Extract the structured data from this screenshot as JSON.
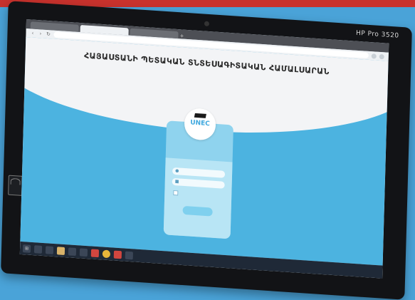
{
  "monitor": {
    "brand": "HP Pro 3520"
  },
  "browser": {
    "tabs": [
      {
        "label": ""
      },
      {
        "label": ""
      },
      {
        "label": ""
      }
    ],
    "url": "",
    "new_tab": "+"
  },
  "page": {
    "title": "ՀԱՅԱՍՏԱՆԻ ՊԵՏԱԿԱՆ ՏՆՏԵՍԱԳԻՏԱԿԱՆ ՀԱՄԱԼՍԱՐԱՆ",
    "subtitle": "",
    "logo_text": "UNEC",
    "username_placeholder": "",
    "password_placeholder": "",
    "remember_label": "",
    "login_label": ""
  },
  "taskbar": {
    "tray": [
      "",
      "",
      ""
    ]
  },
  "colors": {
    "background": "#4aa3d8",
    "page_blue": "#4cb3e0",
    "card": "#8fd3ee"
  }
}
